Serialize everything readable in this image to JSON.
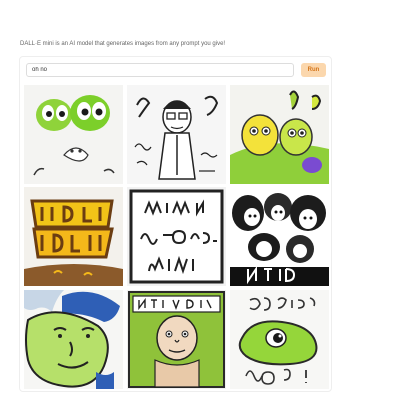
{
  "app": {
    "description": "DALL·E mini is an AI model that generates images from any prompt you give!"
  },
  "prompt": {
    "value": "oh no",
    "placeholder": ""
  },
  "run_button": {
    "label": "Run",
    "bg_color": "#fbd7ad",
    "text_color": "#d4751a"
  },
  "results": {
    "count": 9,
    "items": [
      {
        "desc": "green cartoon ghost characters with big eyes",
        "tile_label": ""
      },
      {
        "desc": "black and white sketch of a man in glasses with scribbled text",
        "tile_label": ""
      },
      {
        "desc": "yellow and green cartoon creatures on white",
        "tile_label": ""
      },
      {
        "desc": "yellow cartoon lettering on brown background",
        "tile_label": ""
      },
      {
        "desc": "black scribbled handwritten text in a framed box",
        "tile_label": ""
      },
      {
        "desc": "black and white cartoon faces crowded together",
        "tile_label": ""
      },
      {
        "desc": "cartoon face with blue hair and green skin",
        "tile_label": ""
      },
      {
        "desc": "bald cartoon man in a green framed comic panel",
        "tile_label": ""
      },
      {
        "desc": "green cartoon blob with scribbled text",
        "tile_label": ""
      }
    ]
  }
}
